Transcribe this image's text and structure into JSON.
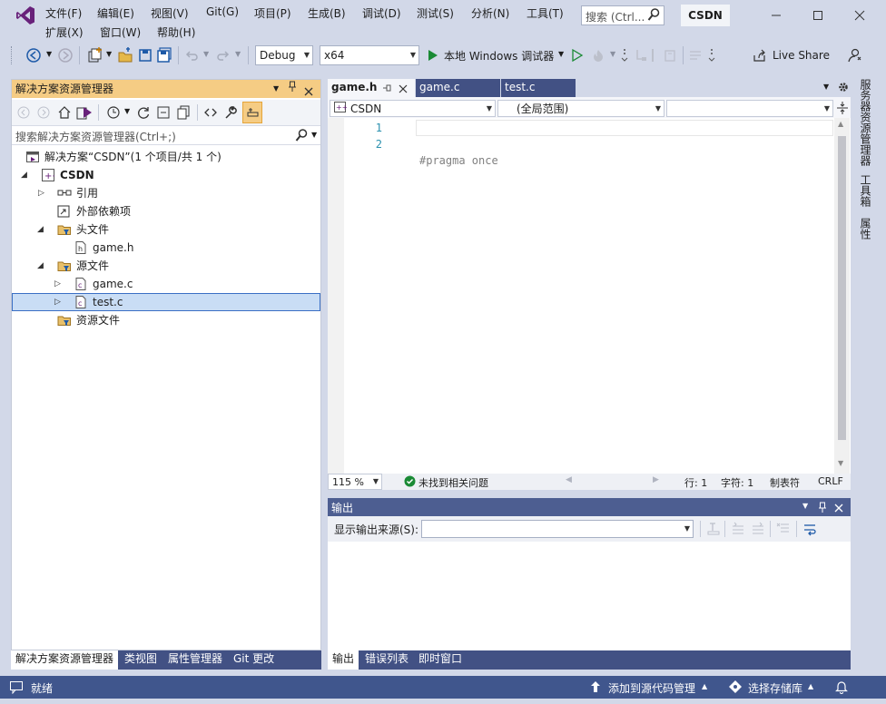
{
  "app": {
    "logo_name": "visual-studio-logo",
    "solution_badge": "CSDN"
  },
  "menu": {
    "file": "文件(F)",
    "edit": "编辑(E)",
    "view": "视图(V)",
    "git": "Git(G)",
    "project": "项目(P)",
    "build": "生成(B)",
    "debug": "调试(D)",
    "test": "测试(S)",
    "analyze": "分析(N)",
    "tools": "工具(T)",
    "extensions": "扩展(X)",
    "window": "窗口(W)",
    "help": "帮助(H)"
  },
  "search": {
    "placeholder": "搜索 (Ctrl..."
  },
  "toolbar": {
    "config": "Debug",
    "platform": "x64",
    "run_label": "本地 Windows 调试器",
    "live_share": "Live Share"
  },
  "solution_explorer": {
    "title": "解决方案资源管理器",
    "search_placeholder": "搜索解决方案资源管理器(Ctrl+;)",
    "solution_label": "解决方案“CSDN”(1 个项目/共 1 个)",
    "project": "CSDN",
    "references": "引用",
    "external_deps": "外部依赖项",
    "header_files": "头文件",
    "header_file_1": "game.h",
    "source_files": "源文件",
    "source_file_1": "game.c",
    "source_file_2": "test.c",
    "resource_files": "资源文件",
    "tabs": [
      "解决方案资源管理器",
      "类视图",
      "属性管理器",
      "Git 更改"
    ]
  },
  "editor": {
    "tabs": [
      "game.h",
      "game.c",
      "test.c"
    ],
    "nav_project": "CSDN",
    "nav_scope": "(全局范围)",
    "nav_member": "",
    "lines": [
      "1",
      "2"
    ],
    "code": [
      "#pragma once",
      ""
    ],
    "zoom": "115 %",
    "issues": "未找到相关问题",
    "line_col": "行: 1",
    "char_col": "字符: 1",
    "tab_mode": "制表符",
    "eol": "CRLF"
  },
  "right_rail": [
    "服务器资源管理器",
    "工具箱",
    "属性"
  ],
  "output": {
    "title": "输出",
    "source_label": "显示输出来源(S):",
    "source_value": "",
    "tabs": [
      "输出",
      "错误列表",
      "即时窗口"
    ]
  },
  "status": {
    "ready": "就绪",
    "add_to_source": "添加到源代码管理",
    "select_repo": "选择存储库"
  },
  "colors": {
    "accent": "#68217a",
    "status_bar": "#40568d",
    "panel_active": "#f5cc84",
    "selection": "#c9ddf5",
    "chrome": "#d2d8e8",
    "tab_dark": "#425184"
  }
}
